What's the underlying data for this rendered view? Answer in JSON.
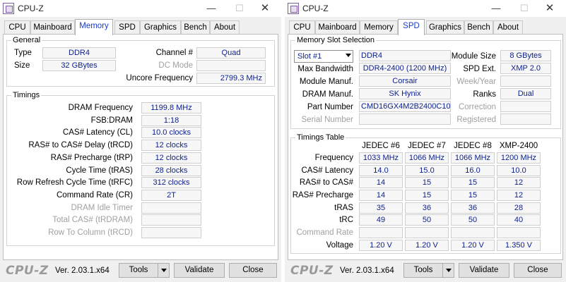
{
  "windows": [
    {
      "title": "CPU-Z",
      "tabs": [
        "CPU",
        "Mainboard",
        "Memory",
        "SPD",
        "Graphics",
        "Bench",
        "About"
      ],
      "active_tab": "Memory",
      "general": {
        "title": "General",
        "type_label": "Type",
        "type_value": "DDR4",
        "size_label": "Size",
        "size_value": "32 GBytes",
        "channel_label": "Channel #",
        "channel_value": "Quad",
        "dcmode_label": "DC Mode",
        "dcmode_value": "",
        "uncore_label": "Uncore Frequency",
        "uncore_value": "2799.3 MHz"
      },
      "timings": {
        "title": "Timings",
        "rows": [
          {
            "label": "DRAM Frequency",
            "value": "1199.8 MHz",
            "disabled": false
          },
          {
            "label": "FSB:DRAM",
            "value": "1:18",
            "disabled": false
          },
          {
            "label": "CAS# Latency (CL)",
            "value": "10.0 clocks",
            "disabled": false
          },
          {
            "label": "RAS# to CAS# Delay (tRCD)",
            "value": "12 clocks",
            "disabled": false
          },
          {
            "label": "RAS# Precharge (tRP)",
            "value": "12 clocks",
            "disabled": false
          },
          {
            "label": "Cycle Time (tRAS)",
            "value": "28 clocks",
            "disabled": false
          },
          {
            "label": "Row Refresh Cycle Time (tRFC)",
            "value": "312 clocks",
            "disabled": false
          },
          {
            "label": "Command Rate (CR)",
            "value": "2T",
            "disabled": false
          },
          {
            "label": "DRAM Idle Timer",
            "value": "",
            "disabled": true
          },
          {
            "label": "Total CAS# (tRDRAM)",
            "value": "",
            "disabled": true
          },
          {
            "label": "Row To Column (tRCD)",
            "value": "",
            "disabled": true
          }
        ]
      },
      "footer": {
        "logo": "CPU-Z",
        "version": "Ver. 2.03.1.x64",
        "tools": "Tools",
        "validate": "Validate",
        "close": "Close"
      }
    },
    {
      "title": "CPU-Z",
      "tabs": [
        "CPU",
        "Mainboard",
        "Memory",
        "SPD",
        "Graphics",
        "Bench",
        "About"
      ],
      "active_tab": "SPD",
      "slot": {
        "title": "Memory Slot Selection",
        "selected": "Slot #1",
        "type_value": "DDR4",
        "module_size_label": "Module Size",
        "module_size_value": "8 GBytes",
        "max_bw_label": "Max Bandwidth",
        "max_bw_value": "DDR4-2400 (1200 MHz)",
        "spd_ext_label": "SPD Ext.",
        "spd_ext_value": "XMP 2.0",
        "module_manuf_label": "Module Manuf.",
        "module_manuf_value": "Corsair",
        "week_year_label": "Week/Year",
        "week_year_value": "",
        "dram_manuf_label": "DRAM Manuf.",
        "dram_manuf_value": "SK Hynix",
        "ranks_label": "Ranks",
        "ranks_value": "Dual",
        "part_label": "Part Number",
        "part_value": "CMD16GX4M2B2400C10",
        "correction_label": "Correction",
        "correction_value": "",
        "serial_label": "Serial Number",
        "serial_value": "",
        "registered_label": "Registered",
        "registered_value": ""
      },
      "timings_table": {
        "title": "Timings Table",
        "columns": [
          "JEDEC #6",
          "JEDEC #7",
          "JEDEC #8",
          "XMP-2400"
        ],
        "rows": [
          {
            "label": "Frequency",
            "values": [
              "1033 MHz",
              "1066 MHz",
              "1066 MHz",
              "1200 MHz"
            ],
            "disabled": false
          },
          {
            "label": "CAS# Latency",
            "values": [
              "14.0",
              "15.0",
              "16.0",
              "10.0"
            ],
            "disabled": false
          },
          {
            "label": "RAS# to CAS#",
            "values": [
              "14",
              "15",
              "15",
              "12"
            ],
            "disabled": false
          },
          {
            "label": "RAS# Precharge",
            "values": [
              "14",
              "15",
              "15",
              "12"
            ],
            "disabled": false
          },
          {
            "label": "tRAS",
            "values": [
              "35",
              "36",
              "36",
              "28"
            ],
            "disabled": false
          },
          {
            "label": "tRC",
            "values": [
              "49",
              "50",
              "50",
              "40"
            ],
            "disabled": false
          },
          {
            "label": "Command Rate",
            "values": [
              "",
              "",
              "",
              ""
            ],
            "disabled": true
          },
          {
            "label": "Voltage",
            "values": [
              "1.20 V",
              "1.20 V",
              "1.20 V",
              "1.350 V"
            ],
            "disabled": false
          }
        ]
      },
      "footer": {
        "logo": "CPU-Z",
        "version": "Ver. 2.03.1.x64",
        "tools": "Tools",
        "validate": "Validate",
        "close": "Close"
      }
    }
  ]
}
